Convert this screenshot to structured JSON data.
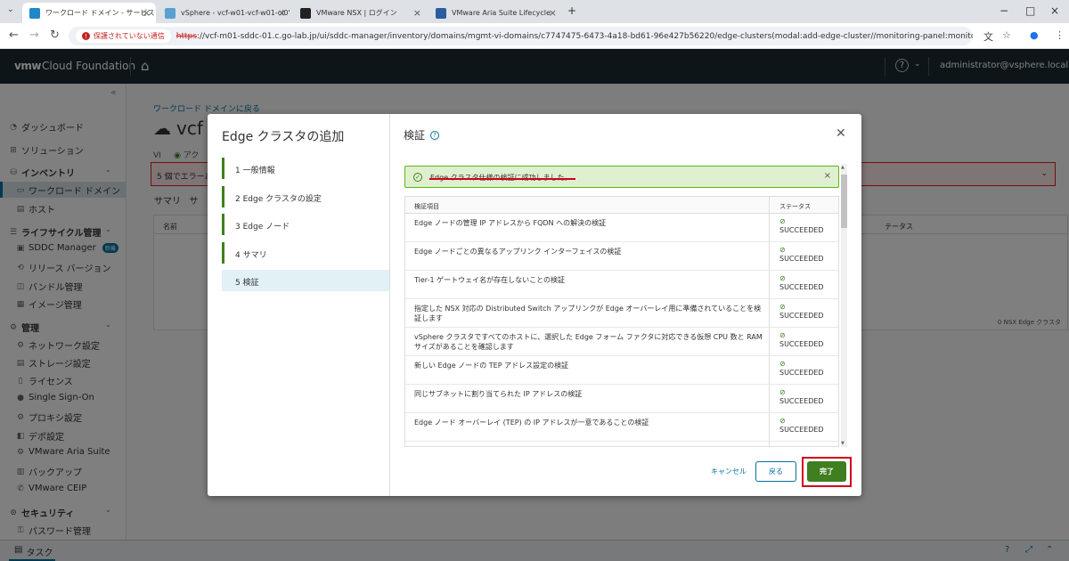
{
  "browser": {
    "tabs": [
      {
        "title": "ワークロード ドメイン - サービス",
        "icon": "vcf-icon"
      },
      {
        "title": "vSphere - vcf-w01-vcf-w01-cl0'",
        "icon": "vsphere-icon"
      },
      {
        "title": "VMware NSX | ログイン",
        "icon": "nsx-icon"
      },
      {
        "title": "VMware Aria Suite Lifecycle",
        "icon": "aria-icon"
      }
    ],
    "security_label": "保護されていない通信",
    "url_scheme": "https",
    "url_rest": "://vcf-m01-sddc-01.c.go-lab.jp/ui/sddc-manager/inventory/domains/mgmt-vi-domains/c7747475-6473-4a18-bd61-96e427b56220/edge-clusters(modal:add-edge-cluster//monitoring-panel:monitoring/tasks)"
  },
  "app": {
    "logo": "vmw",
    "name": "Cloud Foundation",
    "user": "administrator@vsphere.local"
  },
  "sidebar": {
    "items": [
      {
        "label": "ダッシュボード",
        "icon": "dashboard-icon",
        "type": "top"
      },
      {
        "label": "ソリューション",
        "icon": "solution-icon",
        "type": "top"
      },
      {
        "label": "インベントリ",
        "icon": "inventory-icon",
        "type": "hdr"
      },
      {
        "label": "ワークロード ドメイン",
        "icon": "domain-icon",
        "type": "sub"
      },
      {
        "label": "ホスト",
        "icon": "host-icon",
        "type": "sub"
      },
      {
        "label": "ライフサイクル管理",
        "icon": "lifecycle-icon",
        "type": "hdr"
      },
      {
        "label": "SDDC Manager",
        "icon": "sddc-icon",
        "type": "sub",
        "badge": "新機"
      },
      {
        "label": "リリース バージョン",
        "icon": "release-icon",
        "type": "sub"
      },
      {
        "label": "バンドル管理",
        "icon": "bundle-icon",
        "type": "sub"
      },
      {
        "label": "イメージ管理",
        "icon": "image-icon",
        "type": "sub"
      },
      {
        "label": "管理",
        "icon": "admin-icon",
        "type": "hdr"
      },
      {
        "label": "ネットワーク設定",
        "icon": "network-icon",
        "type": "sub"
      },
      {
        "label": "ストレージ設定",
        "icon": "storage-icon",
        "type": "sub"
      },
      {
        "label": "ライセンス",
        "icon": "license-icon",
        "type": "sub"
      },
      {
        "label": "Single Sign-On",
        "icon": "sso-icon",
        "type": "sub"
      },
      {
        "label": "プロキシ設定",
        "icon": "proxy-icon",
        "type": "sub"
      },
      {
        "label": "デポ設定",
        "icon": "depot-icon",
        "type": "sub"
      },
      {
        "label": "VMware Aria Suite",
        "icon": "aria-suite-icon",
        "type": "sub"
      },
      {
        "label": "バックアップ",
        "icon": "backup-icon",
        "type": "sub"
      },
      {
        "label": "VMware CEIP",
        "icon": "ceip-icon",
        "type": "sub"
      },
      {
        "label": "セキュリティ",
        "icon": "security-icon",
        "type": "hdr"
      },
      {
        "label": "パスワード管理",
        "icon": "password-icon",
        "type": "sub"
      }
    ]
  },
  "main": {
    "back_link": "ワークロード ドメインに戻る",
    "title": "vcf",
    "vi_label": "VI",
    "vi_status": "アク",
    "error_text": "5 個でエラーあ",
    "tabs": [
      "サマリ",
      "サ"
    ],
    "col_name": "名前",
    "col_status": "テータス",
    "footer": "0 NSX Edge クラスタ"
  },
  "taskbar": {
    "label": "タスク"
  },
  "modal": {
    "wizard_title": "Edge クラスタの追加",
    "steps": [
      "1 一般情報",
      "2 Edge クラスタの設定",
      "3 Edge ノード",
      "4 サマリ",
      "5 検証"
    ],
    "current_step": 4,
    "section_title": "検証",
    "success_message": "Edge クラスタ仕様の検証に成功しました。",
    "table": {
      "col_item": "検証項目",
      "col_status": "ステータス",
      "rows": [
        {
          "item": "Edge ノードの管理 IP アドレスから FQDN への解決の検証",
          "status": "SUCCEEDED"
        },
        {
          "item": "Edge ノードごとの異なるアップリンク インターフェイスの検証",
          "status": "SUCCEEDED"
        },
        {
          "item": "Tier-1 ゲートウェイ名が存在しないことの検証",
          "status": "SUCCEEDED"
        },
        {
          "item": "指定した NSX 対応の Distributed Switch アップリンクが Edge オーバーレイ用に準備されていることを検証します",
          "status": "SUCCEEDED"
        },
        {
          "item": "vSphere クラスタですべてのホストに、選択した Edge フォーム ファクタに対応できる仮想 CPU 数と RAM サイズがあることを確認します",
          "status": "SUCCEEDED"
        },
        {
          "item": "新しい Edge ノードの TEP アドレス設定の検証",
          "status": "SUCCEEDED"
        },
        {
          "item": "同じサブネットに割り当てられた IP アドレスの検証",
          "status": "SUCCEEDED"
        },
        {
          "item": "Edge ノード オーバーレイ (TEP) の IP アドレスが一意であることの検証",
          "status": "SUCCEEDED"
        }
      ]
    },
    "buttons": {
      "cancel": "キャンセル",
      "back": "戻る",
      "done": "完了"
    }
  },
  "colors": {
    "accent": "#0072a3",
    "success": "#3f7f1f",
    "header": "#1b2a32",
    "highlight": "#d0021b"
  }
}
